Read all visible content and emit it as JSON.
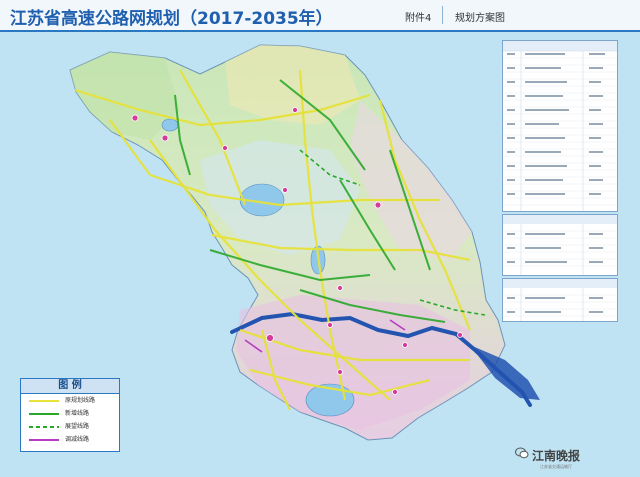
{
  "header": {
    "title": "江苏省高速公路网规划（2017-2035年）",
    "attachment_label": "附件4",
    "attachment_name": "规划方案图"
  },
  "legend": {
    "title": "图 例",
    "items": [
      {
        "label": "原规划线路",
        "color": "#e6e23a",
        "style": "solid"
      },
      {
        "label": "新增线路",
        "color": "#2aa82a",
        "style": "solid"
      },
      {
        "label": "展望线路",
        "color": "#2aa82a",
        "style": "dashed"
      },
      {
        "label": "调减线路",
        "color": "#b73bc2",
        "style": "solid"
      }
    ]
  },
  "watermark": {
    "text": "江南晚报",
    "icon": "wechat-icon"
  },
  "footer_text": "江苏省交通运输厅",
  "colors": {
    "sea": "#bfe3f3",
    "land_north": "#c6e6b6",
    "land_south": "#e8c8e4",
    "existing_road": "#e6e23a",
    "new_road": "#2aa82a",
    "reduced_road": "#b73bc2",
    "river": "#2254b0"
  }
}
